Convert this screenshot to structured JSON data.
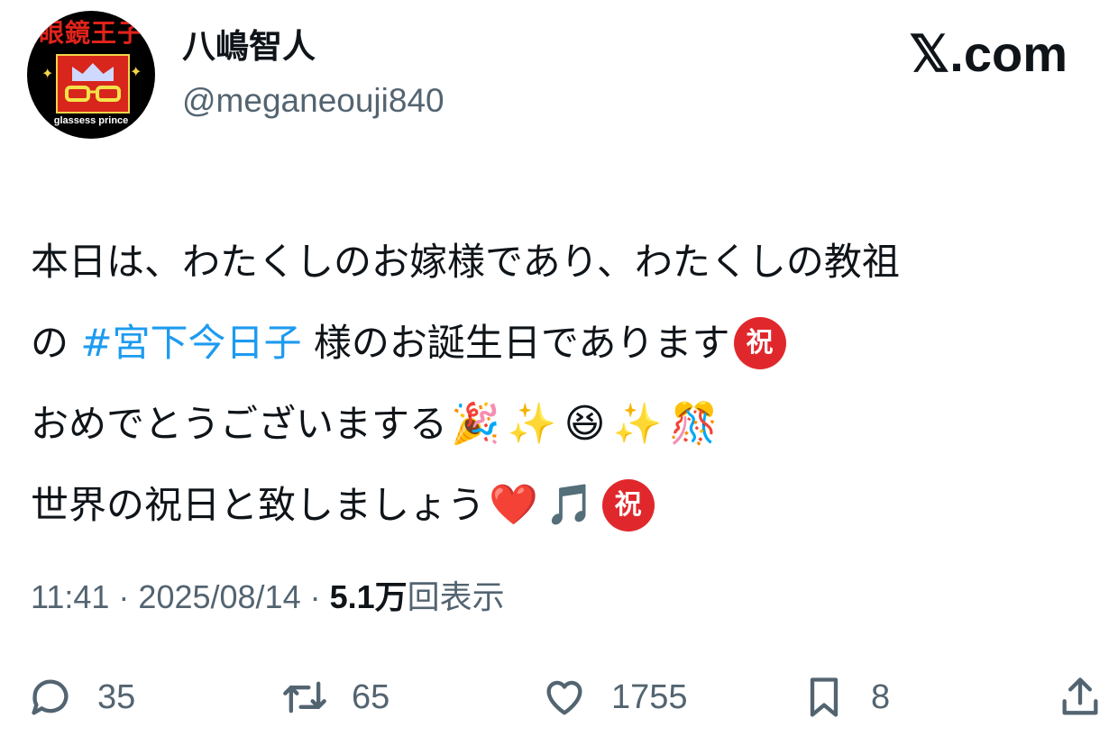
{
  "profile": {
    "avatar_title": "眼鏡王子",
    "avatar_subtitle": "glassess prince",
    "name": "八嶋智人",
    "handle": "@meganeouji840"
  },
  "brand": "𝕏.com",
  "tweet": {
    "line1": "本日は、わたくしのお嫁様であり、わたくしの教祖",
    "line2_prefix": "の ",
    "hashtag": "#宮下今日子",
    "line2_suffix": " 様のお誕生日であります",
    "badge": "祝",
    "line3": "おめでとうございまする",
    "line3_emojis": [
      "🎉",
      "✨",
      "😆",
      "✨",
      "🎊"
    ],
    "line4": "世界の祝日と致しましょう",
    "line4_emojis": [
      "❤️",
      "🎵"
    ]
  },
  "meta": {
    "time": "11:41",
    "date": "2025/08/14",
    "views_count": "5.1万",
    "views_label": "回表示",
    "separator": " · "
  },
  "actions": {
    "replies": "35",
    "reposts": "65",
    "likes": "1755",
    "bookmarks": "8"
  },
  "colors": {
    "hashtag": "#1d9bf0",
    "secondary_text": "#536471",
    "badge_red": "#e0282c"
  }
}
